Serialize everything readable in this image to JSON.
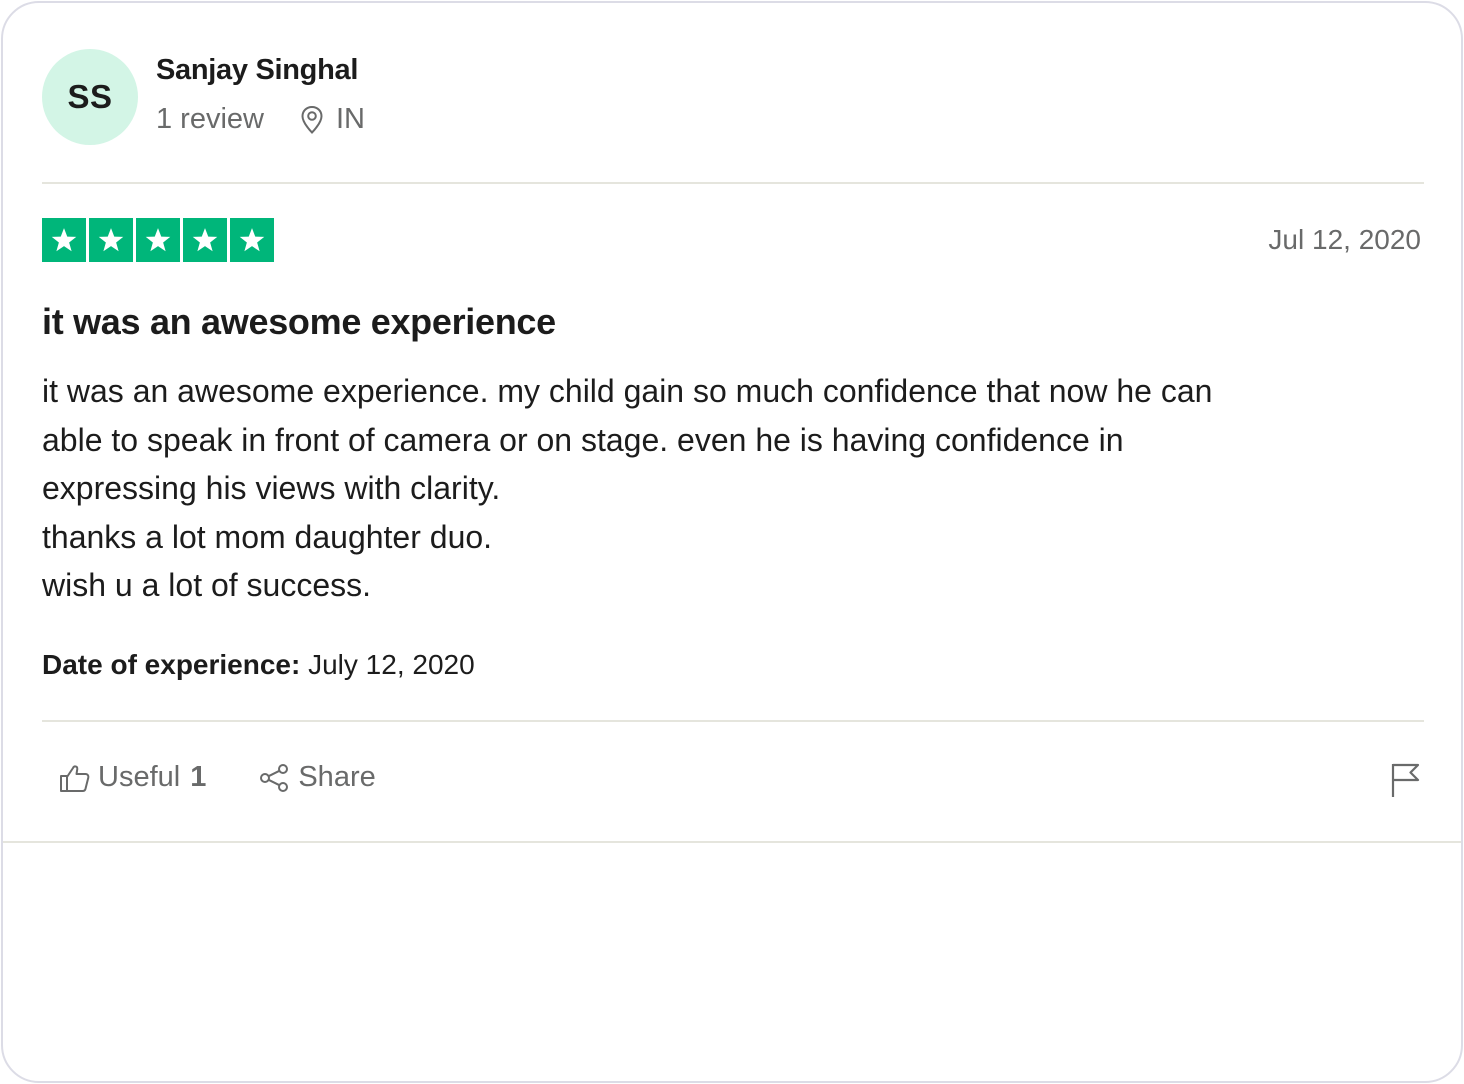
{
  "reviewer": {
    "initials": "SS",
    "name": "Sanjay Singhal",
    "review_count": "1 review",
    "country": "IN",
    "avatar_color": "#d3f5e6"
  },
  "rating": {
    "stars": 5,
    "max": 5,
    "color": "#00b67a"
  },
  "review": {
    "date": "Jul 12, 2020",
    "title": "it was an awesome experience",
    "body": "it was an awesome experience. my child gain so much confidence that now he can\nable to speak in front of camera or on stage. even he is having confidence in\nexpressing his views with clarity.\nthanks a lot mom daughter duo.\nwish u a lot of success.",
    "experience_label": "Date of experience:",
    "experience_date": "July 12, 2020"
  },
  "actions": {
    "useful_label": "Useful",
    "useful_count": "1",
    "share_label": "Share",
    "icons": [
      "thumbs-up-icon",
      "share-icon",
      "flag-icon",
      "location-pin-icon",
      "star-icon"
    ]
  }
}
